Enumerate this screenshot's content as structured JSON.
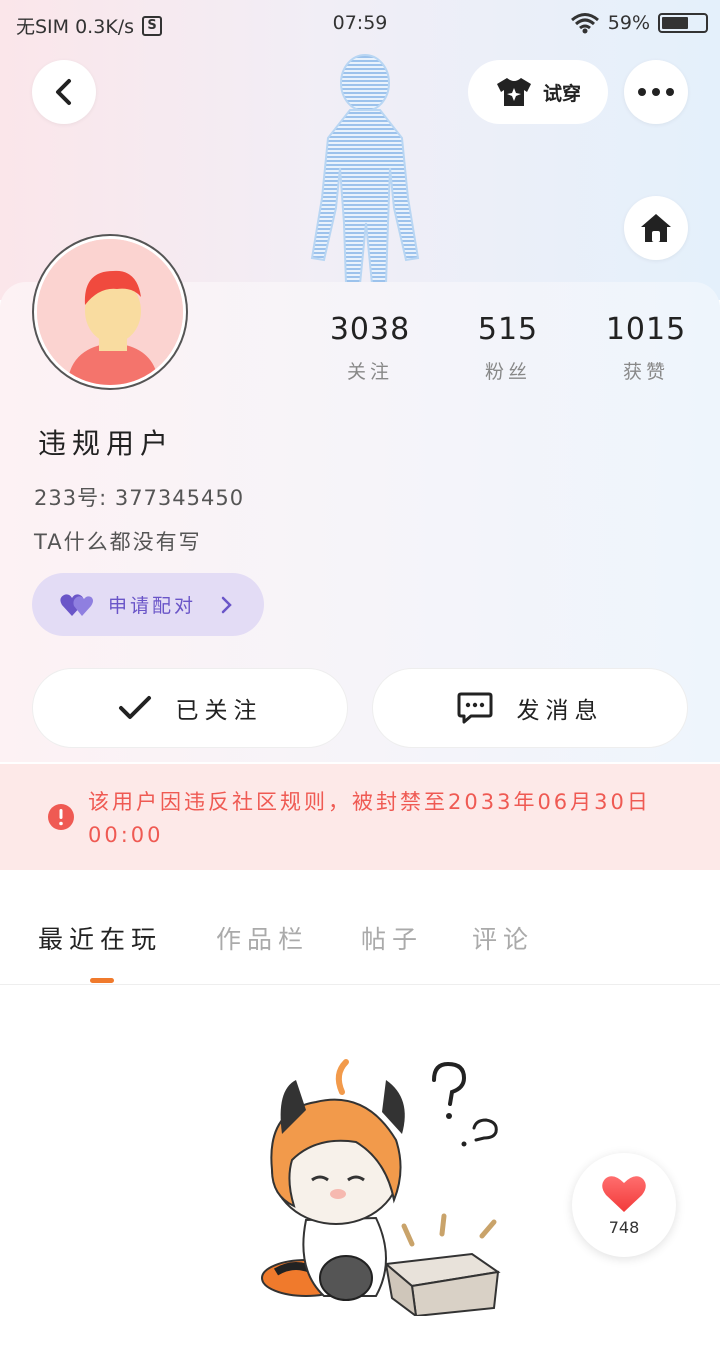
{
  "status_bar": {
    "carrier": "无SIM 0.3K/s",
    "s_badge": "S",
    "time": "07:59",
    "battery": "59%"
  },
  "header": {
    "back_icon": "chevron-left-icon",
    "try_on_label": "试穿",
    "try_on_icon": "shirt-sparkle-icon",
    "more_icon": "ellipsis-icon",
    "home_icon": "home-icon"
  },
  "profile": {
    "username": "违规用户",
    "uid": "233号: 377345450",
    "bio": "TA什么都没有写",
    "stats": [
      {
        "value": "3038",
        "label": "关注"
      },
      {
        "value": "515",
        "label": "粉丝"
      },
      {
        "value": "1015",
        "label": "获赞"
      }
    ],
    "match_button": "申请配对",
    "follow_button": "已关注",
    "message_button": "发消息"
  },
  "ban_notice": {
    "text": "该用户因违反社区规则，被封禁至2033年06月30日 00:00",
    "color": "#ef5a53"
  },
  "tabs": [
    {
      "label": "最近在玩",
      "active": true
    },
    {
      "label": "作品栏",
      "active": false
    },
    {
      "label": "帖子",
      "active": false
    },
    {
      "label": "评论",
      "active": false
    }
  ],
  "like_float": {
    "count": "748",
    "icon": "heart-icon"
  },
  "colors": {
    "accent_orange": "#f07a2c",
    "match_purple": "#6a55c8",
    "warning_red": "#ef5a53"
  }
}
